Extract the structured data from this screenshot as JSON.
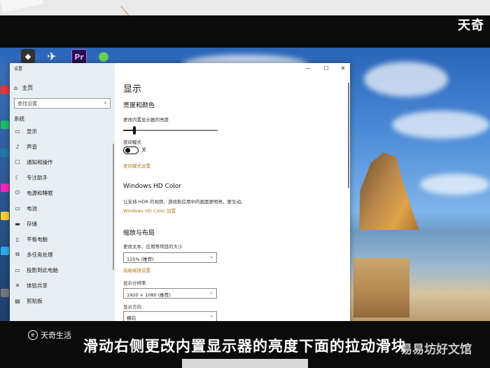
{
  "overlay": {
    "brand": "天奇",
    "subtitle": "滑动右侧更改内置显示器的亮度下面的拉动滑块",
    "watermark_left": "天奇生活",
    "watermark_right": "易易坊好文馆"
  },
  "taskbar": {
    "icons": [
      {
        "name": "unity-icon",
        "text": "◆"
      },
      {
        "name": "premiere-icon",
        "text": "Pr"
      },
      {
        "name": "green-app-icon",
        "text": "●"
      }
    ]
  },
  "window": {
    "title": "设置",
    "controls": {
      "minimize": "—",
      "maximize": "☐",
      "close": "✕"
    }
  },
  "nav": {
    "home": "主页",
    "search_placeholder": "查找设置",
    "section": "系统",
    "items": [
      {
        "label": "显示",
        "icon": "▭"
      },
      {
        "label": "声音",
        "icon": "♪"
      },
      {
        "label": "通知和操作",
        "icon": "☐"
      },
      {
        "label": "专注助手",
        "icon": "☾"
      },
      {
        "label": "电源和睡眠",
        "icon": "⏻"
      },
      {
        "label": "电池",
        "icon": "▭"
      },
      {
        "label": "存储",
        "icon": "▬"
      },
      {
        "label": "平板电脑",
        "icon": "▯"
      },
      {
        "label": "多任务处理",
        "icon": "⧉"
      },
      {
        "label": "投影到此电脑",
        "icon": "▭"
      },
      {
        "label": "体验共享",
        "icon": "✕"
      },
      {
        "label": "剪贴板",
        "icon": "▤"
      }
    ]
  },
  "content": {
    "title": "显示",
    "brightness_heading": "亮度和颜色",
    "brightness_label": "更改内置显示器的亮度",
    "brightness_value": 0.12,
    "night_light_label": "夜间模式",
    "night_light_state": "关",
    "night_light_link": "夜间模式设置",
    "hdr_heading": "Windows HD Color",
    "hdr_desc": "让支持 HDR 的视频、游戏和应用中的画面更明亮、更生动。",
    "hdr_link": "Windows HD Color 设置",
    "scale_heading": "缩放与布局",
    "scale_label": "更改文本、应用等项目的大小",
    "scale_value": "125% (推荐)",
    "advanced_scale_link": "高级缩放设置",
    "resolution_label": "显示分辨率",
    "resolution_value": "1920 × 1080 (推荐)",
    "orientation_label": "显示方向",
    "orientation_value": "横向"
  }
}
